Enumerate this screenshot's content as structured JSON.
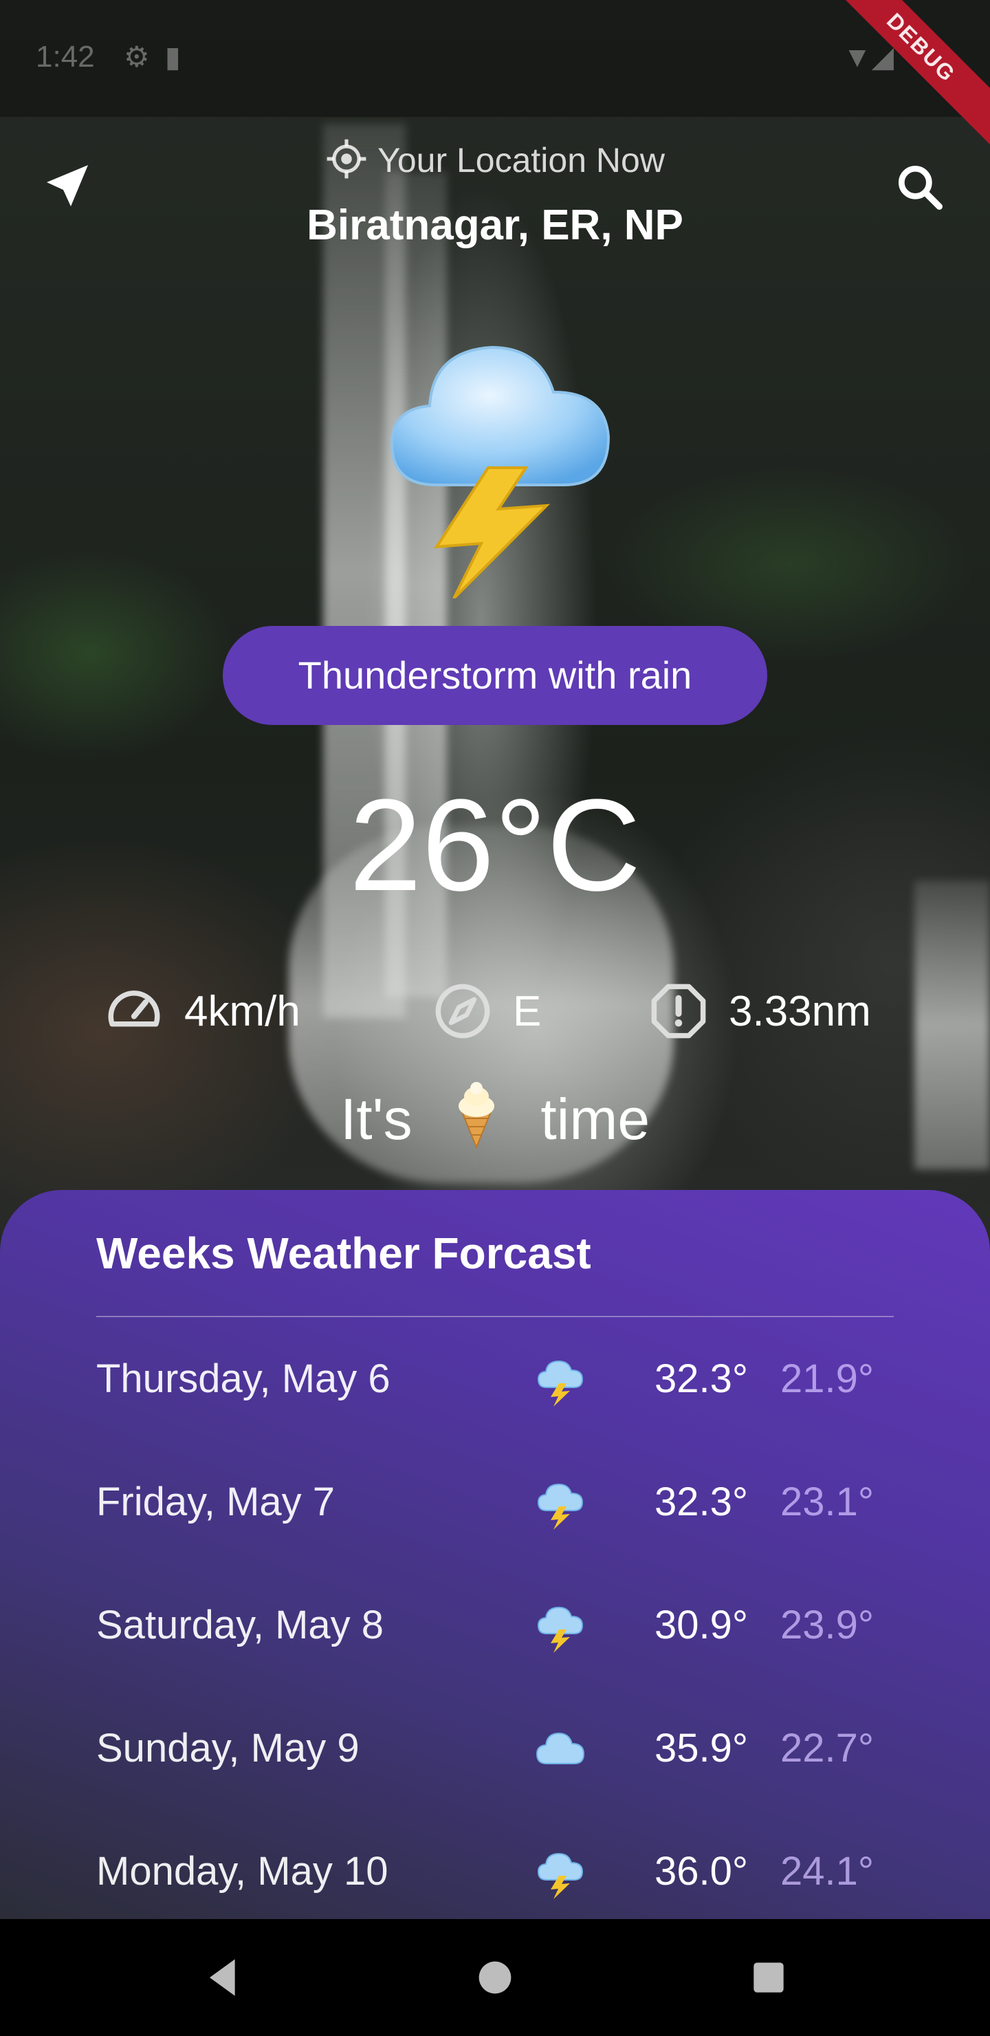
{
  "status_bar": {
    "time": "1:42",
    "debug_banner": "DEBUG"
  },
  "header": {
    "location_label": "Your Location Now",
    "city": "Biratnagar, ER, NP",
    "nav_icon": "navigation-arrow-icon",
    "search_icon": "search-icon",
    "target_icon": "gps-target-icon"
  },
  "current": {
    "weather_icon": "cloud-with-lightning-icon",
    "condition": "Thunderstorm with rain",
    "temperature": "26°C",
    "wind_speed": "4km/h",
    "wind_direction": "E",
    "visibility": "3.33nm",
    "quip_before": "It's",
    "quip_emoji": "ice-cream-icon",
    "quip_after": "time"
  },
  "forecast": {
    "title": "Weeks Weather Forcast",
    "days": [
      {
        "day": "Thursday, May 6",
        "icon": "cloud-with-lightning-icon",
        "high": "32.3°",
        "low": "21.9°"
      },
      {
        "day": "Friday, May 7",
        "icon": "cloud-with-lightning-icon",
        "high": "32.3°",
        "low": "23.1°"
      },
      {
        "day": "Saturday, May 8",
        "icon": "cloud-with-lightning-icon",
        "high": "30.9°",
        "low": "23.9°"
      },
      {
        "day": "Sunday, May 9",
        "icon": "cloud-icon",
        "high": "35.9°",
        "low": "22.7°"
      },
      {
        "day": "Monday, May 10",
        "icon": "cloud-with-lightning-icon",
        "high": "36.0°",
        "low": "24.1°"
      }
    ]
  },
  "colors": {
    "pill": "#5f3bb5",
    "card_gradient_start": "#2b2d38",
    "card_gradient_end": "#6239ba",
    "debug_banner": "#b4192b"
  }
}
